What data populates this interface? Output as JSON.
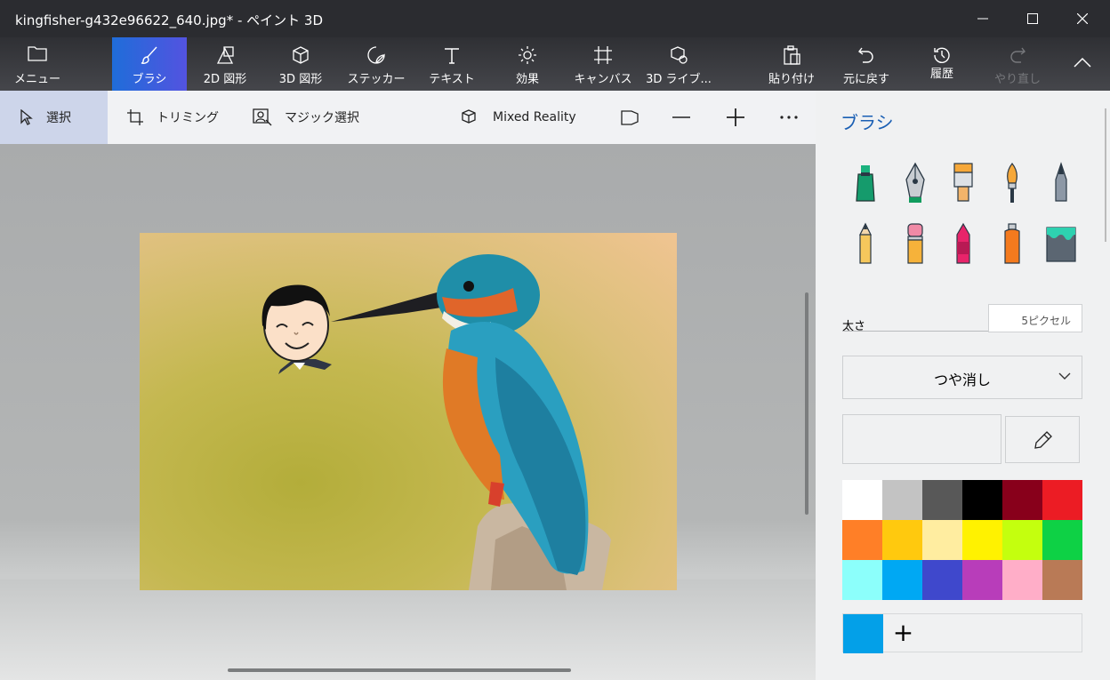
{
  "window": {
    "title": "kingfisher-g432e96622_640.jpg* - ペイント 3D"
  },
  "toolbar": {
    "menu": "メニュー",
    "brush": "ブラシ",
    "shapes2d": "2D 図形",
    "shapes3d": "3D 図形",
    "sticker": "ステッカー",
    "text": "テキスト",
    "effects": "効果",
    "canvas": "キャンバス",
    "library3d": "3D ライブ...",
    "paste": "貼り付け",
    "undo": "元に戻す",
    "history": "履歴",
    "redo": "やり直し"
  },
  "subtoolbar": {
    "select": "選択",
    "crop": "トリミング",
    "magic_select": "マジック選択",
    "mixed_reality": "Mixed Reality"
  },
  "panel": {
    "title": "ブラシ",
    "thickness_label": "太さ",
    "thickness_value": "5ピクセル",
    "finish": "つや消し",
    "add_color": "+"
  },
  "colors": {
    "accent": "#1a5fb4",
    "current": "#03a0e8",
    "palette": [
      "#ffffff",
      "#c3c3c3",
      "#585858",
      "#000000",
      "#88001b",
      "#ec1c24",
      "#ff7f27",
      "#ffc90e",
      "#ffeda0",
      "#fff200",
      "#c4ff0e",
      "#0ed145",
      "#8cfffb",
      "#00a8f3",
      "#3f48cc",
      "#b83dba",
      "#ffaec8",
      "#b97a56"
    ]
  },
  "brushes": [
    "marker",
    "calligraphy-pen",
    "oil-brush",
    "watercolor",
    "pixel-pen",
    "pencil",
    "eraser",
    "crayon",
    "spray-can",
    "fill"
  ]
}
